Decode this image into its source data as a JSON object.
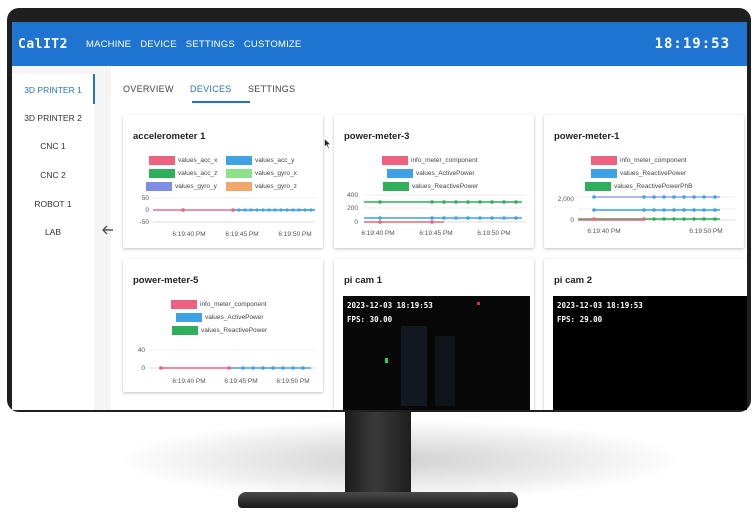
{
  "app": {
    "title": "CalIT2",
    "clock": "18:19:53"
  },
  "nav": [
    {
      "label": "MACHINE"
    },
    {
      "label": "DEVICE"
    },
    {
      "label": "SETTINGS"
    },
    {
      "label": "CUSTOMIZE"
    }
  ],
  "sidebar": {
    "items": [
      {
        "label": "3D PRINTER 1",
        "active": true
      },
      {
        "label": "3D PRINTER 2"
      },
      {
        "label": "CNC 1"
      },
      {
        "label": "CNC 2"
      },
      {
        "label": "ROBOT 1"
      },
      {
        "label": "LAB"
      }
    ]
  },
  "tabs": [
    {
      "label": "OVERVIEW"
    },
    {
      "label": "DEVICES",
      "active": true
    },
    {
      "label": "SETTINGS"
    }
  ],
  "colors": {
    "accent": "#1f74d1",
    "red": "#f06080",
    "blue": "#3fa2e6",
    "green": "#2faf5a",
    "lightgreen": "#8ee08a",
    "purple": "#7e8ee6",
    "orange": "#f3a66b"
  },
  "cards": {
    "acc": {
      "title": "accelerometer 1",
      "legend": [
        "values_acc_x",
        "values_acc_y",
        "values_acc_z",
        "values_gyro_x",
        "values_gyro_y",
        "values_gyro_z"
      ],
      "yticks": [
        "50",
        "0",
        "-50"
      ],
      "xticks": [
        "6:19:40 PM",
        "6:19:45 PM",
        "6:19:50 PM"
      ]
    },
    "pm3": {
      "title": "power-meter-3",
      "legend": [
        "info_meter_component",
        "values_ActivePower",
        "values_ReactivePower"
      ],
      "yticks": [
        "400",
        "200",
        "0"
      ],
      "xticks": [
        "6:19:40 PM",
        "6:19:45 PM",
        "6:19:50 PM"
      ]
    },
    "pm1": {
      "title": "power-meter-1",
      "legend": [
        "info_meter_component",
        "values_ReactivePower",
        "values_ReactivePowerPhB"
      ],
      "yticks": [
        "2,000",
        "0"
      ],
      "xticks": [
        "6:19:40 PM",
        "6:19:50 PM"
      ]
    },
    "pm5": {
      "title": "power-meter-5",
      "legend": [
        "info_meter_component",
        "values_ActivePower",
        "values_ReactivePower"
      ],
      "yticks": [
        "40",
        "0"
      ],
      "xticks": [
        "6:19:40 PM",
        "6:19:45 PM",
        "6:19:50 PM"
      ]
    },
    "cam1": {
      "title": "pi cam 1",
      "timestamp": "2023-12-03 18:19:53",
      "fps": "FPS: 30.00"
    },
    "cam2": {
      "title": "pi cam 2",
      "timestamp": "2023-12-03 18:19:53",
      "fps": "FPS: 29.00"
    }
  }
}
